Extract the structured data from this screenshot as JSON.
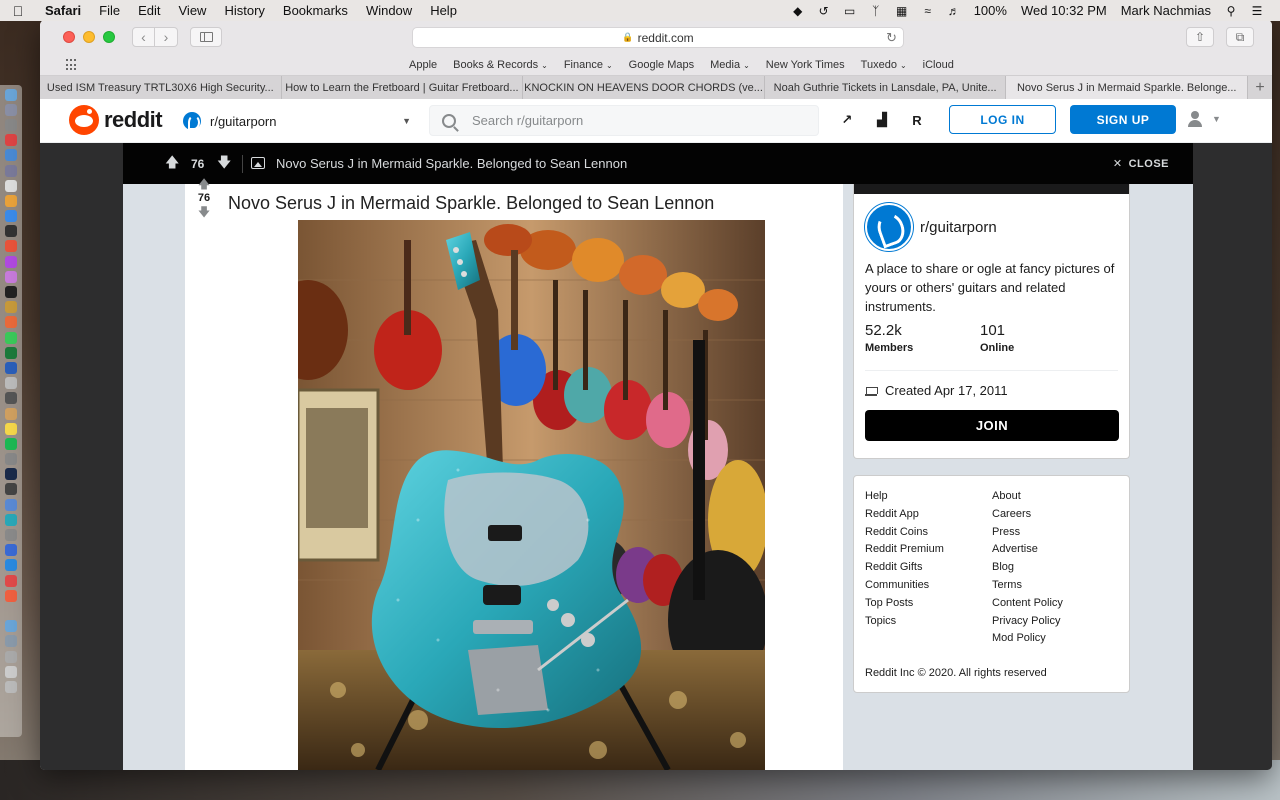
{
  "menubar": {
    "app_name": "Safari",
    "menus": [
      "File",
      "Edit",
      "View",
      "History",
      "Bookmarks",
      "Window",
      "Help"
    ],
    "battery": "100%",
    "clock": "Wed 10:32 PM",
    "user": "Mark Nachmias"
  },
  "browser": {
    "url": "reddit.com",
    "favorites": [
      {
        "label": "Apple",
        "has_menu": false
      },
      {
        "label": "Books & Records",
        "has_menu": true
      },
      {
        "label": "Finance",
        "has_menu": true
      },
      {
        "label": "Google Maps",
        "has_menu": false
      },
      {
        "label": "Media",
        "has_menu": true
      },
      {
        "label": "New York Times",
        "has_menu": false
      },
      {
        "label": "Tuxedo",
        "has_menu": true
      },
      {
        "label": "iCloud",
        "has_menu": false
      }
    ],
    "tabs": [
      {
        "label": "Used ISM Treasury TRTL30X6 High Security...",
        "active": false
      },
      {
        "label": "How to Learn the Fretboard | Guitar Fretboard...",
        "active": false
      },
      {
        "label": "KNOCKIN ON HEAVENS DOOR CHORDS (ve...",
        "active": false
      },
      {
        "label": "Noah Guthrie Tickets in Lansdale, PA, Unite...",
        "active": false
      },
      {
        "label": "Novo Serus J in Mermaid Sparkle. Belonge...",
        "active": true
      }
    ]
  },
  "reddit": {
    "logo_text": "reddit",
    "community": "r/guitarporn",
    "search_placeholder": "Search r/guitarporn",
    "login_label": "LOG IN",
    "signup_label": "SIGN UP",
    "header_icons": [
      "trending-icon",
      "stats-icon",
      "rpan-icon"
    ],
    "header_icon_glyphs": [
      "↗",
      "▟",
      "R"
    ]
  },
  "post": {
    "score": "76",
    "title": "Novo Serus J in Mermaid Sparkle. Belonged to Sean Lennon",
    "close_label": "CLOSE"
  },
  "about": {
    "name": "r/guitarporn",
    "description": "A place to share or ogle at fancy pictures of yours or others' guitars and related instruments.",
    "members_count": "52.2k",
    "members_label": "Members",
    "online_count": "101",
    "online_label": "Online",
    "created": "Created Apr 17, 2011",
    "join_label": "JOIN"
  },
  "footer": {
    "col1": [
      "Help",
      "Reddit App",
      "Reddit Coins",
      "Reddit Premium",
      "Reddit Gifts",
      "Communities",
      "Top Posts",
      "Topics"
    ],
    "col2": [
      "About",
      "Careers",
      "Press",
      "Advertise",
      "Blog",
      "Terms",
      "Content Policy",
      "Privacy Policy",
      "Mod Policy"
    ],
    "copyright": "Reddit Inc © 2020. All rights reserved"
  },
  "colors": {
    "reddit_orange": "#ff4500",
    "reddit_blue": "#0079d3",
    "guitar_sparkle": "#2aa8b8"
  }
}
